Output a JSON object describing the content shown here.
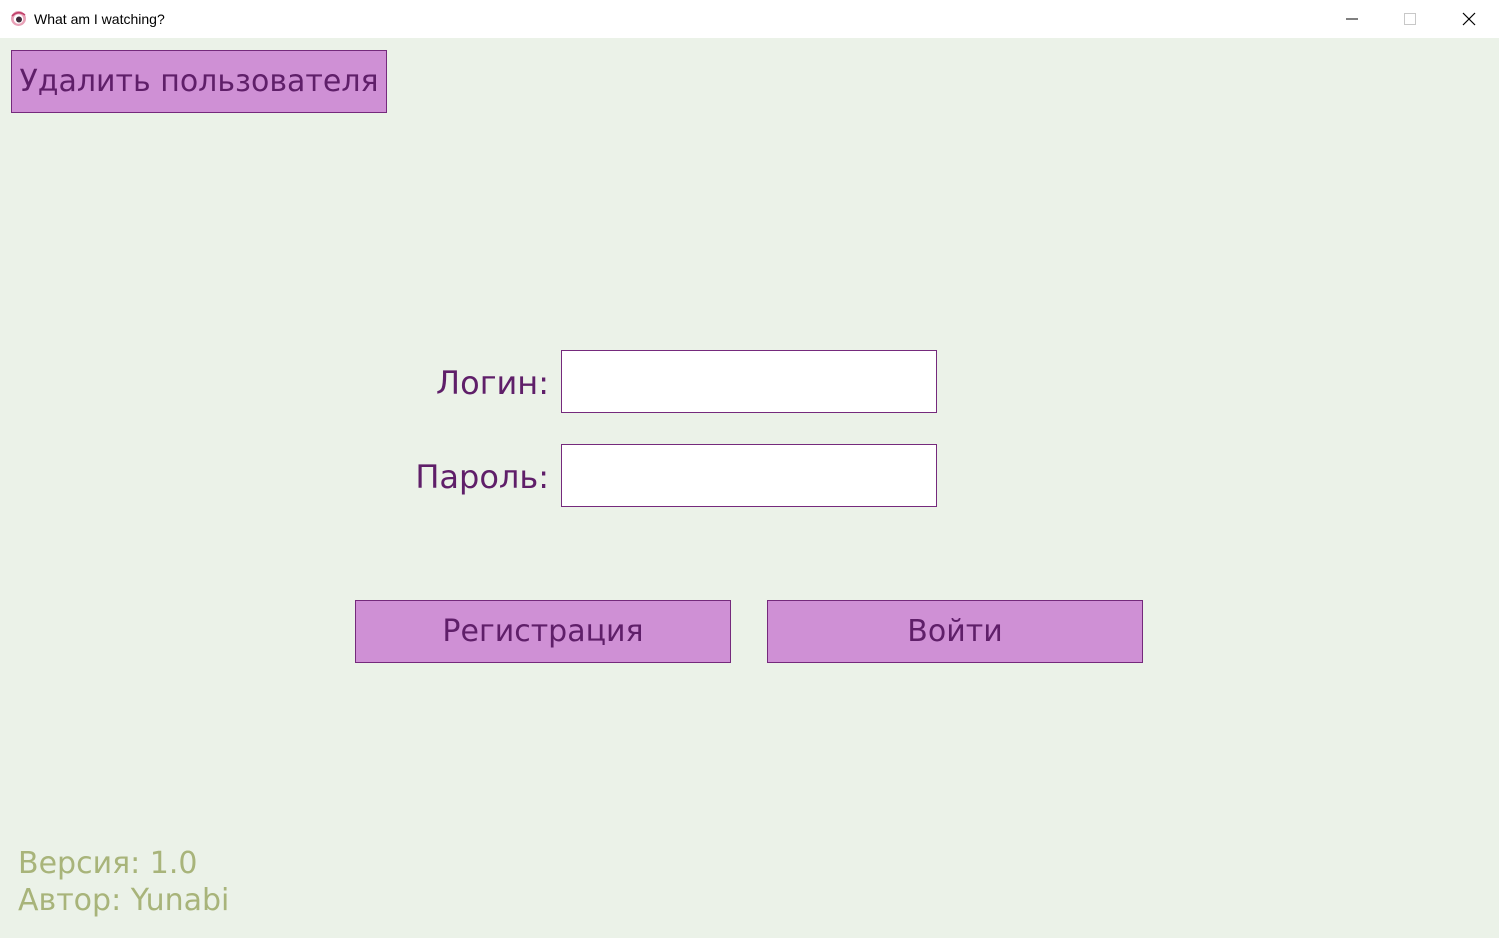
{
  "window": {
    "title": "What am I watching?",
    "icon": "app-logo-icon",
    "controls": [
      "minimize-icon",
      "maximize-icon",
      "close-icon"
    ]
  },
  "toolbar": {
    "delete_user_label": "Удалить пользователя"
  },
  "form": {
    "login_label": "Логин:",
    "login_value": "",
    "password_label": "Пароль:",
    "password_value": ""
  },
  "actions": {
    "register_label": "Регистрация",
    "login_label": "Войти"
  },
  "footer": {
    "version": "Версия: 1.0",
    "author": "Автор: Yunabi"
  },
  "colors": {
    "background": "#ebf2e8",
    "button_fill": "#cf90d5",
    "button_border": "#752a7c",
    "label_text": "#5f1f69",
    "footer_text": "#a8b47a"
  }
}
